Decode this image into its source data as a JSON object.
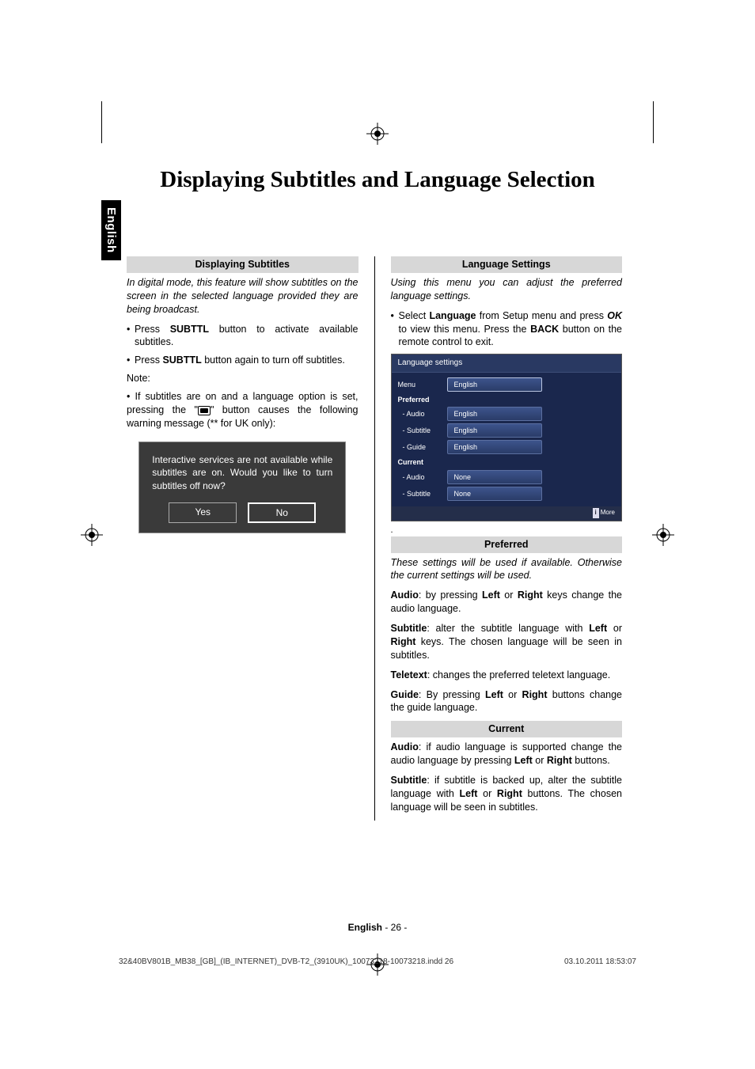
{
  "page": {
    "lang_tab": "English",
    "title": "Displaying Subtitles and Language Selection"
  },
  "left": {
    "heading": "Displaying Subtitles",
    "intro": "In digital mode, this feature will show subtitles on the screen in the selected language provided they are being broadcast.",
    "bullet1_pre": "Press ",
    "bullet1_b": "SUBTTL",
    "bullet1_post": " button to activate available subtitles.",
    "bullet2_pre": "Press ",
    "bullet2_b": "SUBTTL",
    "bullet2_post": " button again to turn off subtitles.",
    "note_label": "Note:",
    "note_text_pre": "If  subtitles are on and a language option is set, pressing the \"",
    "note_text_post": "\" button causes the following warning message (** for UK only):",
    "dialog": {
      "text": "Interactive services are not available while subtitles are on. Would you like to turn subtitles off now?",
      "yes": "Yes",
      "no": "No"
    }
  },
  "right": {
    "heading": "Language Settings",
    "intro": "Using this menu you can adjust the preferred language settings.",
    "bullet1_pre": "Select ",
    "bullet1_b1": "Language",
    "bullet1_mid1": " from Setup menu and press ",
    "bullet1_b2": "OK",
    "bullet1_mid2": " to view this menu. Press the ",
    "bullet1_b3": "BACK",
    "bullet1_post": " button on the remote control to exit.",
    "preferred_heading": "Preferred",
    "preferred_intro": "These settings will be used if available. Otherwise the current settings will be used.",
    "audio_pref_pre": "Audio",
    "audio_pref_mid1": ": by pressing ",
    "audio_pref_b1": "Left",
    "audio_pref_mid2": " or ",
    "audio_pref_b2": "Right",
    "audio_pref_post": " keys change the audio language.",
    "subtitle_pref_pre": "Subtitle",
    "subtitle_pref_mid1": ": alter the subtitle language with ",
    "subtitle_pref_b1": "Left",
    "subtitle_pref_mid2": " or ",
    "subtitle_pref_b2": "Right",
    "subtitle_pref_post": " keys. The chosen language will be seen in subtitles.",
    "teletext_pref_pre": "Teletext",
    "teletext_pref_post": ": changes the preferred teletext language.",
    "guide_pref_pre": "Guide",
    "guide_pref_mid1": ": By pressing ",
    "guide_pref_b1": "Left",
    "guide_pref_mid2": " or ",
    "guide_pref_b2": "Right",
    "guide_pref_post": "  buttons change the guide language.",
    "current_heading": "Current",
    "audio_cur_pre": "Audio",
    "audio_cur_mid1": ":  if audio language is supported change the audio language by pressing ",
    "audio_cur_b1": "Left",
    "audio_cur_mid2": " or ",
    "audio_cur_b2": "Right",
    "audio_cur_post": " buttons.",
    "subtitle_cur_pre": "Subtitle",
    "subtitle_cur_mid1": ": if subtitle is backed up, alter the subtitle language with ",
    "subtitle_cur_b1": "Left",
    "subtitle_cur_mid2": " or ",
    "subtitle_cur_b2": "Right",
    "subtitle_cur_post": " buttons. The chosen language will be seen in subtitles."
  },
  "tvshot": {
    "title": "Language settings",
    "menu_label": "Menu",
    "menu_value": "English",
    "preferred_label": "Preferred",
    "audio_label": "- Audio",
    "audio_value": "English",
    "subtitle_label": "- Subtitle",
    "subtitle_value": "English",
    "guide_label": "- Guide",
    "guide_value": "English",
    "current_label": "Current",
    "cur_audio_label": "- Audio",
    "cur_audio_value": "None",
    "cur_subtitle_label": "- Subtitle",
    "cur_subtitle_value": "None",
    "footer_badge": "i",
    "footer_text": "More"
  },
  "footer": {
    "lang": "English",
    "page": " - 26 -",
    "file": "32&40BV801B_MB38_[GB]_(IB_INTERNET)_DVB-T2_(3910UK)_10073218-10073218.indd   26",
    "ts": "03.10.2011   18:53:07"
  }
}
